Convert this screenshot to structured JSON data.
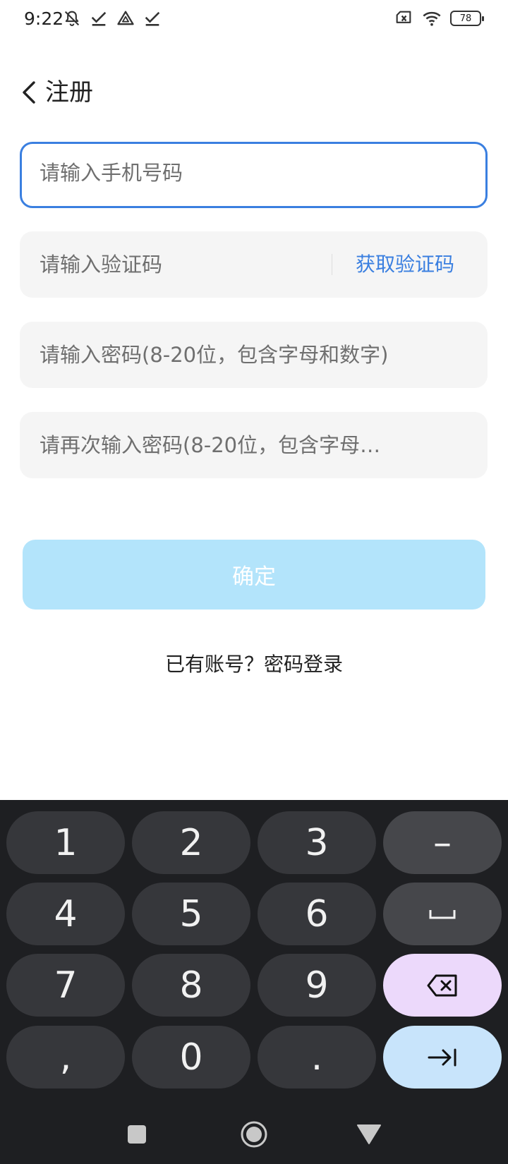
{
  "status_bar": {
    "time": "9:22",
    "left_icons": [
      "bell-off-icon",
      "check-icon",
      "drive-icon",
      "check-icon"
    ],
    "right_icons": [
      "sim-x-icon",
      "wifi-icon"
    ],
    "battery": "78"
  },
  "header": {
    "title": "注册"
  },
  "form": {
    "phone_placeholder": "请输入手机号码",
    "code_placeholder": "请输入验证码",
    "get_code_label": "获取验证码",
    "password_placeholder": "请输入密码(8-20位，包含字母和数字)",
    "confirm_password_placeholder": "请再次输入密码(8-20位，包含字母…",
    "submit_label": "确定",
    "login_link": "已有账号？密码登录"
  },
  "keyboard": {
    "keys": [
      "1",
      "2",
      "3",
      "–",
      "4",
      "5",
      "6",
      "␣",
      "7",
      "8",
      "9",
      "⌫",
      ",",
      "0",
      ".",
      "⇥"
    ]
  },
  "colors": {
    "accent": "#3a7fe0",
    "button_disabled": "#b3e4fb",
    "field_background": "#f5f5f5",
    "keyboard_background": "#1e1f22",
    "key_background": "#36373b",
    "delete_key": "#ecd9fb",
    "enter_key": "#c8e4fb"
  }
}
